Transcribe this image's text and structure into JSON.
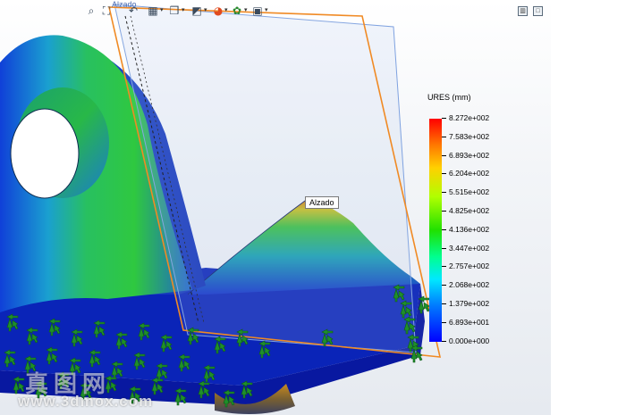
{
  "viewport": {
    "plane_tag": "Alzado",
    "tooltip": "Alzado"
  },
  "toolbar": {
    "items": [
      {
        "icon": "zoom-to-fit-icon",
        "glyph": "🔍"
      },
      {
        "icon": "zoom-area-icon",
        "glyph": "⛶"
      },
      {
        "icon": "previous-view-icon",
        "glyph": "↶"
      },
      {
        "icon": "section-view-icon",
        "glyph": "▦"
      },
      {
        "icon": "view-orientation-icon",
        "glyph": "❒"
      },
      {
        "icon": "display-style-icon",
        "glyph": "◩"
      },
      {
        "icon": "hide-show-items-icon",
        "glyph": "◉"
      },
      {
        "icon": "edit-appearance-icon",
        "glyph": "●"
      },
      {
        "icon": "apply-scene-icon",
        "glyph": "✿"
      },
      {
        "icon": "view-settings-icon",
        "glyph": "▣"
      }
    ]
  },
  "legend": {
    "title": "URES (mm)",
    "labels": [
      "8.272e+002",
      "7.583e+002",
      "6.893e+002",
      "6.204e+002",
      "5.515e+002",
      "4.825e+002",
      "4.136e+002",
      "3.447e+002",
      "2.757e+002",
      "2.068e+002",
      "1.379e+002",
      "6.893e+001",
      "0.000e+000"
    ]
  },
  "watermark": {
    "logo": "真图网",
    "url": "www.3dmox.com"
  },
  "colors": {
    "plane_orange": "#f08a24",
    "plane_blue": "#7fa2e0",
    "fixture_green": "#1f8f2a"
  }
}
